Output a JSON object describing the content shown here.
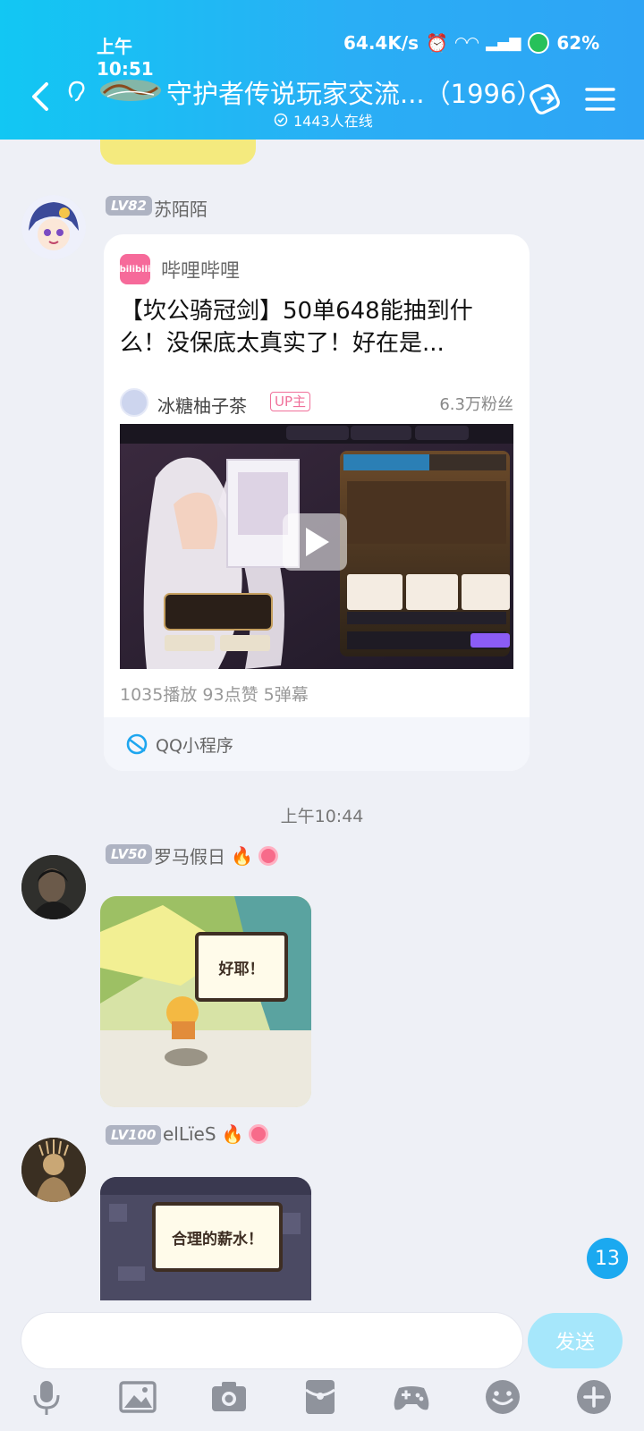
{
  "status_bar": {
    "time": "上午10:51",
    "speed": "64.4K/s",
    "battery": "62%"
  },
  "header": {
    "title": "守护者传说玩家交流...（1996）",
    "online": "1443人在线"
  },
  "messages": [
    {
      "level": "LV82",
      "name": "苏陌陌",
      "card": {
        "source": "哔哩哔哩",
        "source_logo": "bilibili",
        "title": "【坎公骑冠剑】50单648能抽到什么！没保底太真实了！好在是...",
        "uploader": "冰糖柚子茶",
        "uploader_tag": "UP主",
        "fans": "6.3万粉丝",
        "stats": "1035播放   93点赞   5弹幕",
        "footer": "QQ小程序"
      }
    },
    {
      "level": "LV50",
      "name": "罗马假日",
      "sticker_text": "好耶！"
    },
    {
      "level": "LV100",
      "name": "elLïeS",
      "sticker_text": "合理的薪水！"
    }
  ],
  "timestamp": "上午10:44",
  "unread_count": "13",
  "input": {
    "send_label": "发送"
  },
  "toolbar": [
    "microphone-icon",
    "image-icon",
    "camera-icon",
    "red-packet-icon",
    "gamepad-icon",
    "emoji-icon",
    "plus-icon"
  ]
}
